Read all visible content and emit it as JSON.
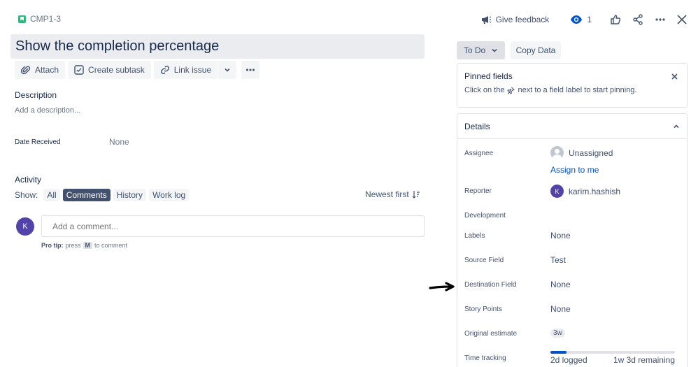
{
  "issue_key": "CMP1-3",
  "header": {
    "give_feedback": "Give feedback",
    "watch_count": "1"
  },
  "title": "Show the completion percentage",
  "toolbar": {
    "attach": "Attach",
    "create_subtask": "Create subtask",
    "link_issue": "Link issue"
  },
  "description": {
    "label": "Description",
    "placeholder": "Add a description..."
  },
  "date_received": {
    "label": "Date Received",
    "value": "None"
  },
  "activity": {
    "label": "Activity",
    "show_label": "Show:",
    "filters": [
      "All",
      "Comments",
      "History",
      "Work log"
    ],
    "active_filter": "Comments",
    "sort": "Newest first",
    "user_initial": "K",
    "comment_placeholder": "Add a comment...",
    "pro_tip_bold": "Pro tip:",
    "pro_tip_press": "press",
    "pro_tip_key": "M",
    "pro_tip_rest": "to comment"
  },
  "status": {
    "label": "To Do",
    "copy_data": "Copy Data"
  },
  "pinned": {
    "title": "Pinned fields",
    "text_before": "Click on the",
    "text_after": "next to a field label to start pinning."
  },
  "details": {
    "title": "Details",
    "assignee_label": "Assignee",
    "assignee_value": "Unassigned",
    "assign_to_me": "Assign to me",
    "reporter_label": "Reporter",
    "reporter_initial": "K",
    "reporter_value": "karim.hashish",
    "development_label": "Development",
    "labels_label": "Labels",
    "labels_value": "None",
    "source_label": "Source Field",
    "source_value": "Test",
    "destination_label": "Destination Field",
    "destination_value": "None",
    "story_points_label": "Story Points",
    "story_points_value": "None",
    "original_estimate_label": "Original estimate",
    "original_estimate_value": "3w",
    "time_tracking_label": "Time tracking",
    "logged": "2d logged",
    "remaining": "1w 3d remaining",
    "time_progress_pct": 13
  },
  "colors": {
    "accent": "#0052cc",
    "story": "#36b37e",
    "avatar": "#5243aa",
    "annotation_arrow": "#000000"
  }
}
